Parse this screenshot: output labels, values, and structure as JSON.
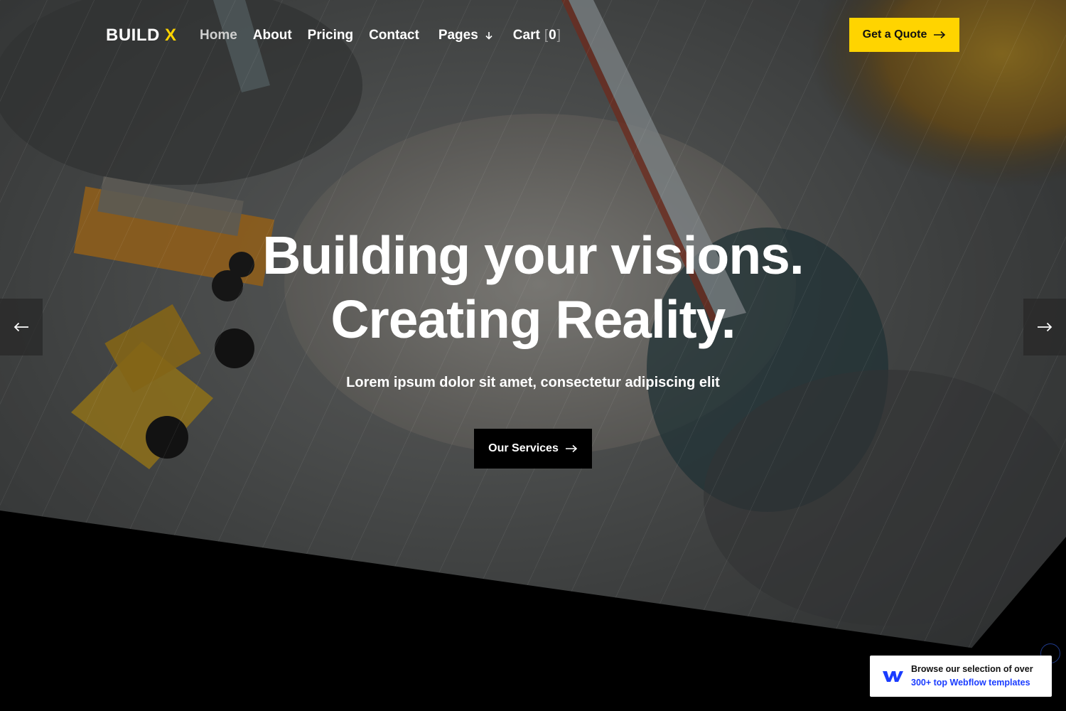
{
  "brand": {
    "name": "BUILD",
    "mark": "X",
    "accent": "#FFD400"
  },
  "nav": {
    "items": [
      {
        "label": "Home",
        "active": true
      },
      {
        "label": "About"
      },
      {
        "label": "Pricing"
      },
      {
        "label": "Contact"
      },
      {
        "label": "Pages",
        "icon": "chevron-down-icon"
      }
    ],
    "cart": {
      "label": "Cart",
      "open": "[",
      "count": "0",
      "close": "]"
    },
    "cta": {
      "label": "Get a Quote",
      "icon": "arrow-right-icon"
    }
  },
  "hero": {
    "title_line1": "Building your visions.",
    "title_line2": "Creating Reality.",
    "subtitle": "Lorem ipsum dolor sit amet, consectetur adipiscing elit",
    "button": {
      "label": "Our Services",
      "icon": "arrow-right-icon"
    },
    "prev_icon": "arrow-left-icon",
    "next_icon": "arrow-right-icon"
  },
  "webflow_badge": {
    "line1": "Browse our selection of over",
    "line2": "300+ top Webflow templates",
    "icon": "webflow-logo-icon",
    "link_color": "#1a3cff"
  }
}
